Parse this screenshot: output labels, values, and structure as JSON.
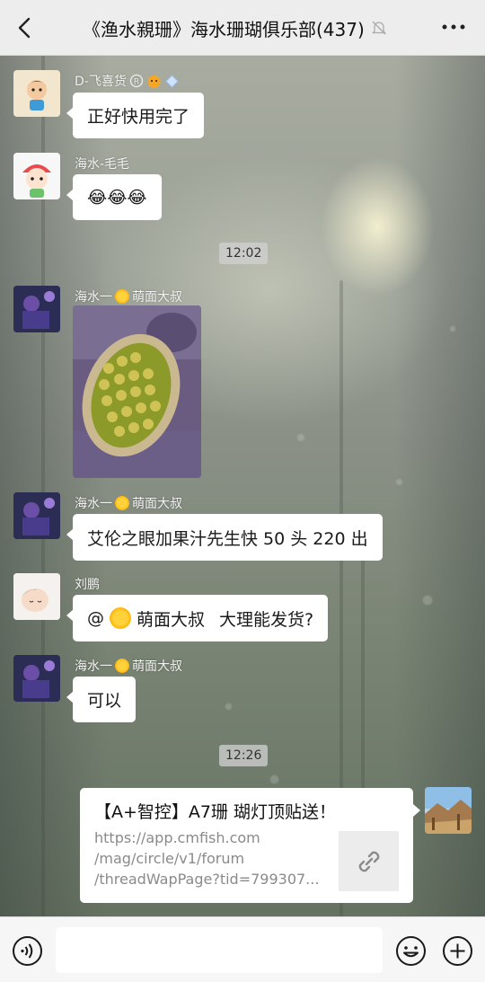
{
  "header": {
    "title": "《渔水親珊》海水珊瑚俱乐部(437)",
    "muted": true
  },
  "messages": [
    {
      "sender_name": "D-飞喜货",
      "sender_badges": [
        "registered-mark",
        "tiger-face",
        "diamond"
      ],
      "text": "正好快用完了"
    },
    {
      "sender_name": "海水-毛毛",
      "text": "😂😂😂"
    },
    {
      "timestamp": "12:02"
    },
    {
      "sender_name_prefix": "海水一",
      "sender_name_suffix": "萌面大叔",
      "type": "image",
      "image_subject": "coral-photo"
    },
    {
      "sender_name_prefix": "海水一",
      "sender_name_suffix": "萌面大叔",
      "text": "艾伦之眼加果汁先生快 50 头 220 出"
    },
    {
      "sender_name": "刘鹏",
      "mention_prefix": "@",
      "mention_name": "萌面大叔",
      "text_after_mention": "大理能发货?"
    },
    {
      "sender_name_prefix": "海水一",
      "sender_name_suffix": "萌面大叔",
      "text": "可以"
    },
    {
      "timestamp": "12:26"
    },
    {
      "type": "link",
      "outgoing": true,
      "link_title": "【A+智控】A7珊 瑚灯顶贴送！",
      "url_lines": [
        "https://app.cmfish.com",
        "/mag/circle/v1/forum",
        "/threadWapPage?tid=799307..."
      ]
    }
  ],
  "input_bar": {
    "placeholder": "",
    "value": ""
  },
  "icons": {
    "back": "chevron-left-icon",
    "mute": "bell-off-icon",
    "more": "more-horizontal-icon",
    "voice": "voice-icon",
    "emoji": "emoji-icon",
    "plus": "plus-icon",
    "link": "link-icon"
  },
  "colors": {
    "topbar": "#ededed",
    "bubble": "#ffffff",
    "input_bar": "#f6f6f6"
  }
}
